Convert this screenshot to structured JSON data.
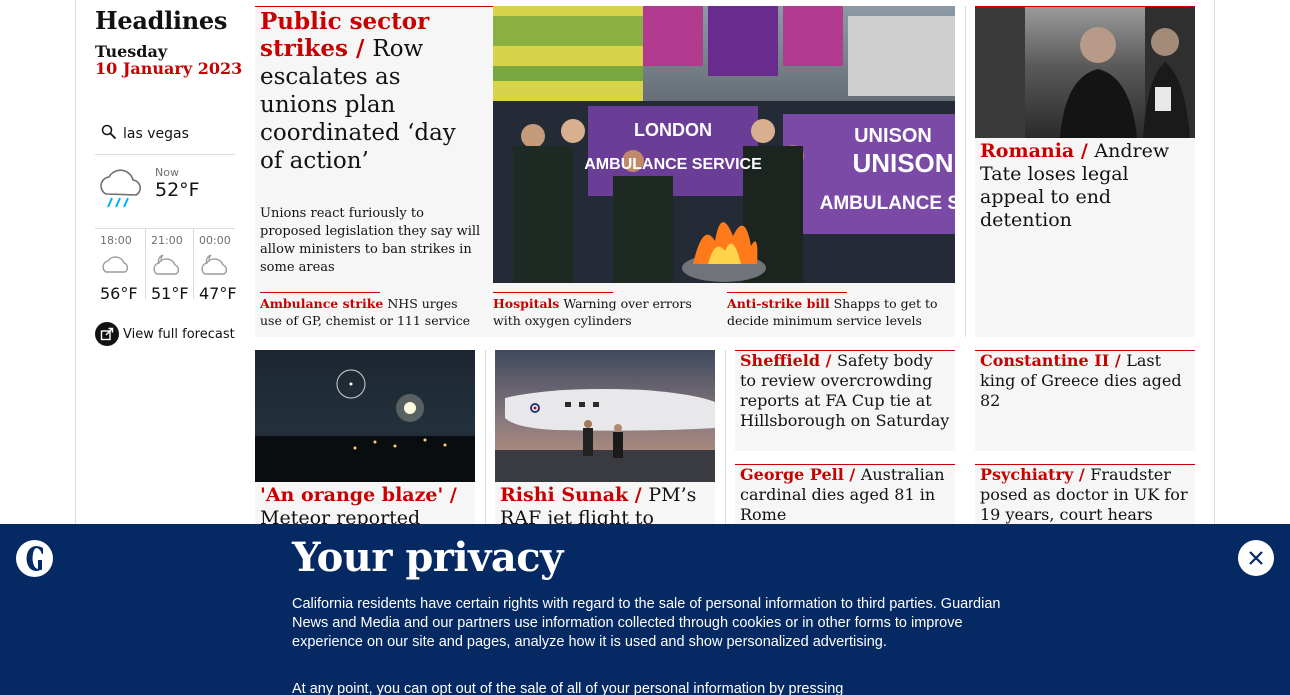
{
  "section": {
    "title": "Headlines",
    "day": "Tuesday",
    "date": "10 January 2023"
  },
  "search": {
    "value": "las vegas",
    "icon": "search-icon"
  },
  "weather": {
    "now_label": "Now",
    "now_temp": "52°F",
    "now_icon": "rain-cloud-icon",
    "forecast": [
      {
        "time": "18:00",
        "temp": "56°F",
        "icon": "cloud-icon"
      },
      {
        "time": "21:00",
        "temp": "51°F",
        "icon": "moon-cloud-icon"
      },
      {
        "time": "00:00",
        "temp": "47°F",
        "icon": "moon-cloud-icon"
      }
    ],
    "link_label": "View full forecast"
  },
  "lead": {
    "kicker": "Public sector strikes /",
    "headline": "Row escalates as unions plan coordinated ‘day of action’",
    "standfirst": "Unions react furiously to proposed legislation they say will allow ministers to ban strikes in some areas",
    "subs": [
      {
        "kicker": "Ambulance strike",
        "text": "NHS urges use of GP, chemist or 111 service"
      },
      {
        "kicker": "Hospitals",
        "text": "Warning over errors with oxygen cylinders"
      },
      {
        "kicker": "Anti-strike bill",
        "text": "Shapps to get to decide minimum service levels"
      }
    ],
    "image_banners": [
      "LONDON",
      "UNISON",
      "AMBULANCE SERVICE",
      "UNISON",
      "AMBULANCE SER"
    ]
  },
  "side_top": {
    "kicker": "Romania /",
    "headline": "Andrew Tate loses legal appeal to end detention"
  },
  "row2": [
    {
      "kicker": "'An orange blaze' /",
      "headline": "Meteor reported"
    },
    {
      "kicker": "Rishi Sunak /",
      "headline": "PM’s RAF jet flight to Leeds"
    }
  ],
  "small_stories": [
    {
      "kicker": "Sheffield /",
      "headline": "Safety body to review overcrowding reports at FA Cup tie at Hillsborough on Saturday"
    },
    {
      "kicker": "Constantine II /",
      "headline": "Last king of Greece dies aged 82"
    },
    {
      "kicker": "George Pell /",
      "headline": "Australian cardinal dies aged 81 in Rome"
    },
    {
      "kicker": "Psychiatry /",
      "headline": "Fraudster posed as doctor in UK for 19 years, court hears"
    }
  ],
  "privacy": {
    "title": "Your privacy",
    "body": "California residents have certain rights with regard to the sale of personal information to third parties. Guardian News and Media and our partners use information collected through cookies or in other forms to improve experience on our site and pages, analyze how it is used and show personalized advertising.",
    "body2": "At any point, you can opt out of the sale of all of your personal information by pressing"
  },
  "colors": {
    "accent": "#c70000",
    "banner": "#052962",
    "card": "#f6f6f6"
  }
}
